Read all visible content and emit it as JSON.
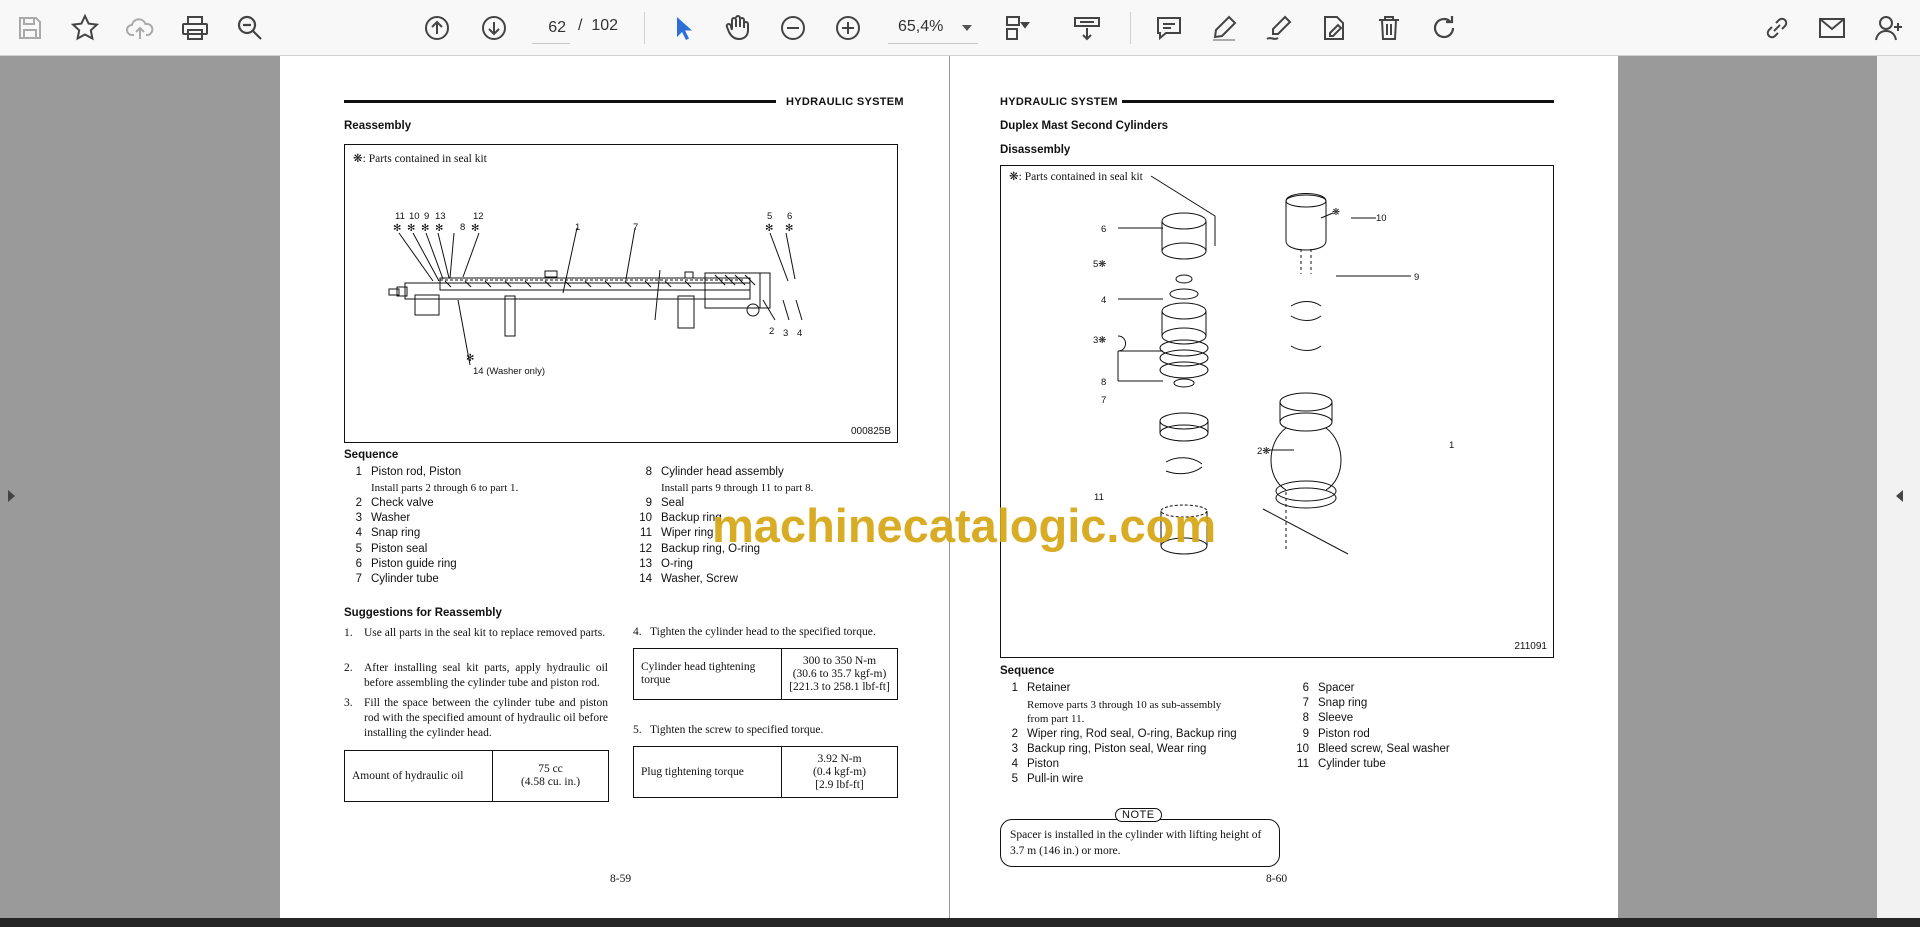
{
  "toolbar": {
    "icons": [
      "save-icon",
      "bookmark-star-icon",
      "upload-cloud-icon",
      "print-icon",
      "zoom-tool-icon",
      "previous-page-icon",
      "next-page-icon",
      "select-cursor-icon",
      "hand-tool-icon",
      "zoom-out-icon",
      "zoom-in-icon",
      "fit-page-icon",
      "scroll-mode-icon",
      "comment-icon",
      "highlight-icon",
      "draw-icon",
      "fill-sign-icon",
      "delete-icon",
      "rotate-icon",
      "share-link-icon",
      "email-icon",
      "add-user-icon"
    ],
    "page_current": "62",
    "page_separator": "/",
    "page_total": "102",
    "zoom": "65,4%",
    "accent": "#2d6fd6"
  },
  "watermark": "machinecatalogic.com",
  "left_page": {
    "header": "HYDRAULIC SYSTEM",
    "title": "Reassembly",
    "figure": {
      "kit_note": "❋: Parts contained in seal kit",
      "code": "000825B",
      "callouts": [
        "11",
        "10",
        "9",
        "13",
        "12",
        "8",
        "1",
        "7",
        "5",
        "6",
        "2",
        "3",
        "4"
      ],
      "washer_label": "14 (Washer only)"
    },
    "sequence_title": "Sequence",
    "sequence_col1": [
      {
        "n": "1",
        "t": "Piston rod, Piston"
      },
      {
        "n": "2",
        "t": "Check valve"
      },
      {
        "n": "3",
        "t": "Washer"
      },
      {
        "n": "4",
        "t": "Snap ring"
      },
      {
        "n": "5",
        "t": "Piston seal"
      },
      {
        "n": "6",
        "t": "Piston guide ring"
      },
      {
        "n": "7",
        "t": "Cylinder tube"
      }
    ],
    "sequence_col1_note": "Install parts 2 through 6 to part 1.",
    "sequence_col2": [
      {
        "n": "8",
        "t": "Cylinder head assembly"
      },
      {
        "n": "9",
        "t": "Seal"
      },
      {
        "n": "10",
        "t": "Backup ring"
      },
      {
        "n": "11",
        "t": "Wiper ring"
      },
      {
        "n": "12",
        "t": "Backup ring, O-ring"
      },
      {
        "n": "13",
        "t": "O-ring"
      },
      {
        "n": "14",
        "t": "Washer, Screw"
      }
    ],
    "sequence_col2_note": "Install parts 9 through 11 to part 8.",
    "suggestions_title": "Suggestions for Reassembly",
    "suggestions": [
      {
        "n": "1.",
        "t": "Use all parts in the seal kit to replace removed parts."
      },
      {
        "n": "2.",
        "t": "After installing seal kit parts, apply hydraulic oil before assembling the cylinder tube and piston rod."
      },
      {
        "n": "3.",
        "t": "Fill the space between the cylinder tube and piston rod with the specified amount of hydraulic oil before installing the cylinder head."
      }
    ],
    "oil_table": {
      "label": "Amount of hydraulic oil",
      "value": "75 cc\n(4.58 cu. in.)"
    },
    "step4": {
      "n": "4.",
      "t": "Tighten the cylinder head to the specified torque."
    },
    "head_torque_table": {
      "label": "Cylinder head tightening torque",
      "value": "300 to 350 N-m\n(30.6 to 35.7 kgf-m)\n[221.3 to 258.1 lbf-ft]"
    },
    "step5": {
      "n": "5.",
      "t": "Tighten the screw to specified torque."
    },
    "plug_torque_table": {
      "label": "Plug tightening torque",
      "value": "3.92 N-m\n(0.4 kgf-m)\n[2.9 lbf-ft]"
    },
    "page_number": "8-59"
  },
  "right_page": {
    "header": "HYDRAULIC SYSTEM",
    "title": "Duplex Mast Second Cylinders",
    "subtitle": "Disassembly",
    "figure": {
      "kit_note": "❋: Parts contained in seal kit",
      "code": "211091",
      "callouts": [
        "6",
        "5❋",
        "4",
        "3❋",
        "8",
        "7",
        "11",
        "❋",
        "10",
        "9",
        "2❋",
        "1"
      ]
    },
    "sequence_title": "Sequence",
    "sequence_col1": [
      {
        "n": "1",
        "t": "Retainer"
      },
      {
        "n": "2",
        "t": "Wiper ring, Rod seal, O-ring, Backup ring"
      },
      {
        "n": "3",
        "t": "Backup ring, Piston seal, Wear ring"
      },
      {
        "n": "4",
        "t": "Piston"
      },
      {
        "n": "5",
        "t": "Pull-in wire"
      }
    ],
    "sequence_col1_note": "Remove parts 3 through 10 as sub-assembly from part 11.",
    "sequence_col2": [
      {
        "n": "6",
        "t": "Spacer"
      },
      {
        "n": "7",
        "t": "Snap ring"
      },
      {
        "n": "8",
        "t": "Sleeve"
      },
      {
        "n": "9",
        "t": "Piston rod"
      },
      {
        "n": "10",
        "t": "Bleed screw, Seal washer"
      },
      {
        "n": "11",
        "t": "Cylinder tube"
      }
    ],
    "note_label": "NOTE",
    "note_text": "Spacer is installed in the cylinder with lifting height of 3.7 m (146 in.) or more.",
    "page_number": "8-60"
  }
}
